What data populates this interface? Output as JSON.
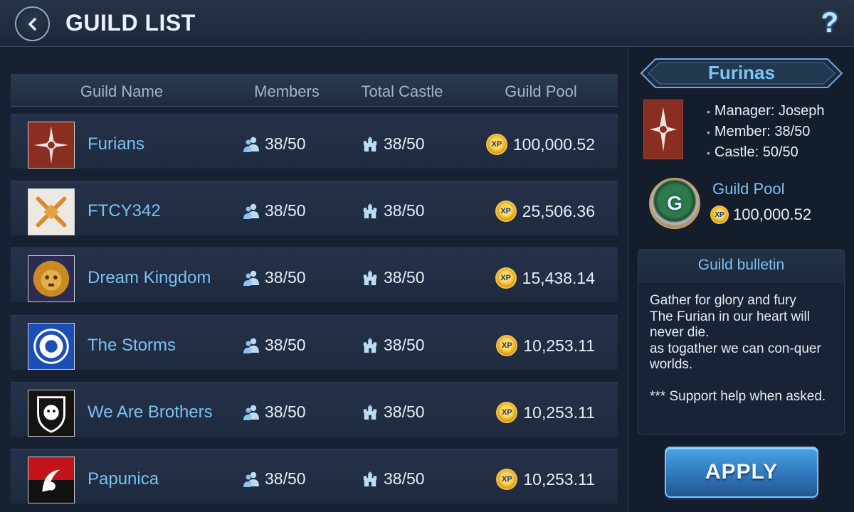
{
  "header": {
    "title": "GUILD LIST",
    "help_label": "?"
  },
  "columns": {
    "name": "Guild Name",
    "members": "Members",
    "castle": "Total Castle",
    "pool": "Guild Pool"
  },
  "xp_label": "XP",
  "guilds": [
    {
      "name": "Furians",
      "members": "38/50",
      "castle": "38/50",
      "pool": "100,000.52",
      "emblem": "red-compass-crest"
    },
    {
      "name": "FTCY342",
      "members": "38/50",
      "castle": "38/50",
      "pool": "25,506.36",
      "emblem": "crossed-swords-crest"
    },
    {
      "name": "Dream Kingdom",
      "members": "38/50",
      "castle": "38/50",
      "pool": "15,438.14",
      "emblem": "golden-lion-crest"
    },
    {
      "name": "The Storms",
      "members": "38/50",
      "castle": "38/50",
      "pool": "10,253.11",
      "emblem": "blue-sun-crest"
    },
    {
      "name": "We Are Brothers",
      "members": "38/50",
      "castle": "38/50",
      "pool": "10,253.11",
      "emblem": "lion-shield-crest"
    },
    {
      "name": "Papunica",
      "members": "38/50",
      "castle": "38/50",
      "pool": "10,253.11",
      "emblem": "red-black-reaper-crest"
    }
  ],
  "selected": {
    "name": "Furinas",
    "manager": "Manager: Joseph",
    "member": "Member: 38/50",
    "castle": "Castle: 50/50",
    "pool_label": "Guild Pool",
    "pool_badge": "G",
    "pool_value": "100,000.52",
    "bulletin_title": "Guild bulletin",
    "bulletin_text": "Gather for glory and fury\nThe Furian in our heart will never die.\nas togather we can con-quer worlds.\n\n*** Support help when asked.",
    "apply_label": "APPLY"
  }
}
